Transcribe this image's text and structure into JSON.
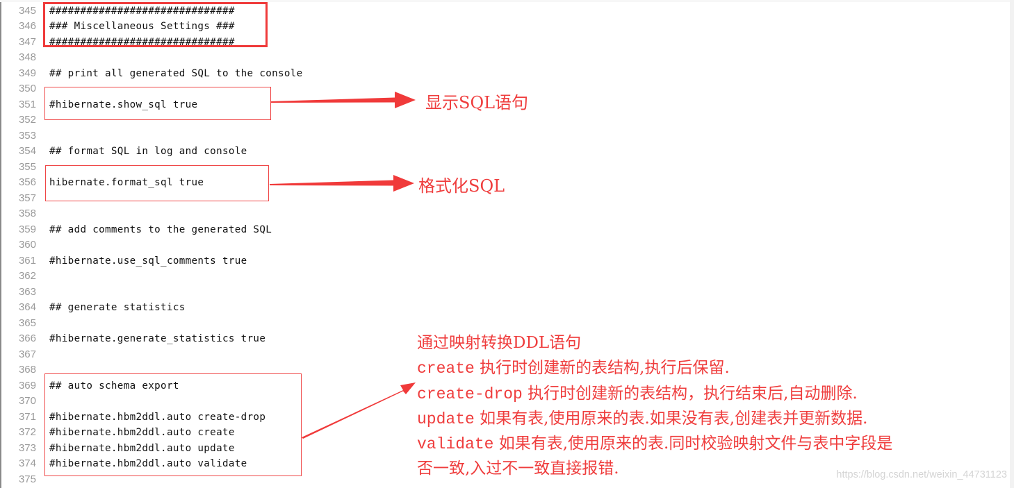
{
  "editor": {
    "lines": [
      {
        "number": "345",
        "text": "##############################"
      },
      {
        "number": "346",
        "text": "### Miscellaneous Settings ###"
      },
      {
        "number": "347",
        "text": "##############################"
      },
      {
        "number": "348",
        "text": ""
      },
      {
        "number": "349",
        "text": "## print all generated SQL to the console"
      },
      {
        "number": "350",
        "text": ""
      },
      {
        "number": "351",
        "text": "#hibernate.show_sql true"
      },
      {
        "number": "352",
        "text": ""
      },
      {
        "number": "353",
        "text": ""
      },
      {
        "number": "354",
        "text": "## format SQL in log and console"
      },
      {
        "number": "355",
        "text": ""
      },
      {
        "number": "356",
        "text": "hibernate.format_sql true"
      },
      {
        "number": "357",
        "text": ""
      },
      {
        "number": "358",
        "text": ""
      },
      {
        "number": "359",
        "text": "## add comments to the generated SQL"
      },
      {
        "number": "360",
        "text": ""
      },
      {
        "number": "361",
        "text": "#hibernate.use_sql_comments true"
      },
      {
        "number": "362",
        "text": ""
      },
      {
        "number": "363",
        "text": ""
      },
      {
        "number": "364",
        "text": "## generate statistics"
      },
      {
        "number": "365",
        "text": ""
      },
      {
        "number": "366",
        "text": "#hibernate.generate_statistics true"
      },
      {
        "number": "367",
        "text": ""
      },
      {
        "number": "368",
        "text": ""
      },
      {
        "number": "369",
        "text": "## auto schema export"
      },
      {
        "number": "370",
        "text": ""
      },
      {
        "number": "371",
        "text": "#hibernate.hbm2ddl.auto create-drop"
      },
      {
        "number": "372",
        "text": "#hibernate.hbm2ddl.auto create"
      },
      {
        "number": "373",
        "text": "#hibernate.hbm2ddl.auto update"
      },
      {
        "number": "374",
        "text": "#hibernate.hbm2ddl.auto validate"
      },
      {
        "number": "375",
        "text": ""
      }
    ]
  },
  "annotations": {
    "color": "#ef3d3d",
    "show_sql_note": "显示SQL语句",
    "format_sql_note": "格式化SQL",
    "ddl_notes": {
      "title": "通过映射转换DDL语句",
      "items": [
        {
          "keyword": "create",
          "desc": " 执行时创建新的表结构,执行后保留."
        },
        {
          "keyword": "create-drop",
          "desc": " 执行时创建新的表结构，执行结束后,自动删除."
        },
        {
          "keyword": "update",
          "desc": " 如果有表,使用原来的表.如果没有表,创建表并更新数据."
        },
        {
          "keyword": "validate",
          "desc": " 如果有表,使用原来的表.同时校验映射文件与表中字段是"
        }
      ],
      "continuation": "否一致,入过不一致直接报错."
    }
  },
  "watermark": "https://blog.csdn.net/weixin_44731123"
}
